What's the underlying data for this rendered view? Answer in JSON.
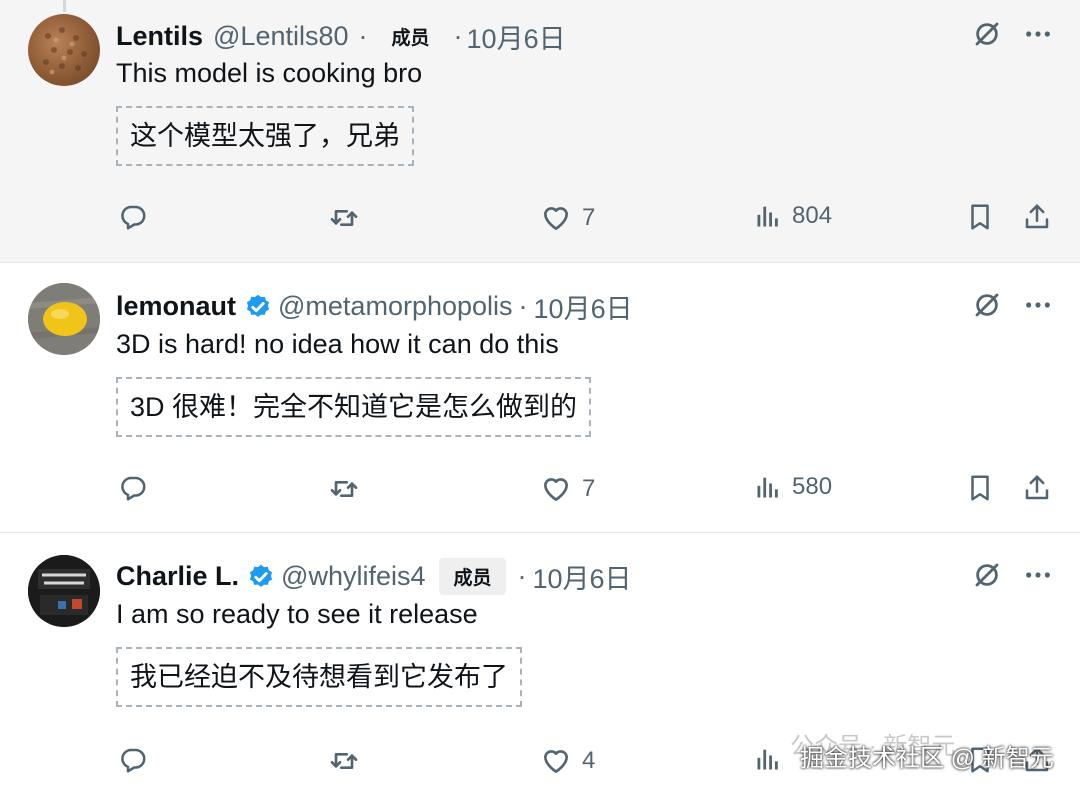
{
  "tweets": [
    {
      "name": "Lentils",
      "handle": "@Lentils80",
      "badge": "成员",
      "date": "10月6日",
      "text": "This model is cooking bro",
      "translation": "这个模型太强了，兄弟",
      "likes": "7",
      "views": "804",
      "verified": false
    },
    {
      "name": "lemonaut",
      "handle": "@metamorphopolis",
      "date": "10月6日",
      "text": "3D is hard! no idea how it can do this",
      "translation": "3D 很难！完全不知道它是怎么做到的",
      "likes": "7",
      "views": "580",
      "verified": true
    },
    {
      "name": "Charlie L.",
      "handle": "@whylifeis4",
      "badge": "成员",
      "date": "10月6日",
      "text": "I am so ready to see it release",
      "translation": "我已经迫不及待想看到它发布了",
      "likes": "4",
      "views": "",
      "verified": true
    }
  ],
  "separator": "·",
  "watermark": "掘金技术社区 @ 新智元",
  "watermark_faint": "公众号 · 新智元",
  "colors": {
    "verified": "#1d9bf0",
    "muted": "#536471",
    "text": "#0f1419"
  },
  "icons": [
    "grok-icon",
    "more-icon",
    "reply-icon",
    "retweet-icon",
    "like-icon",
    "views-icon",
    "bookmark-icon",
    "share-icon"
  ]
}
